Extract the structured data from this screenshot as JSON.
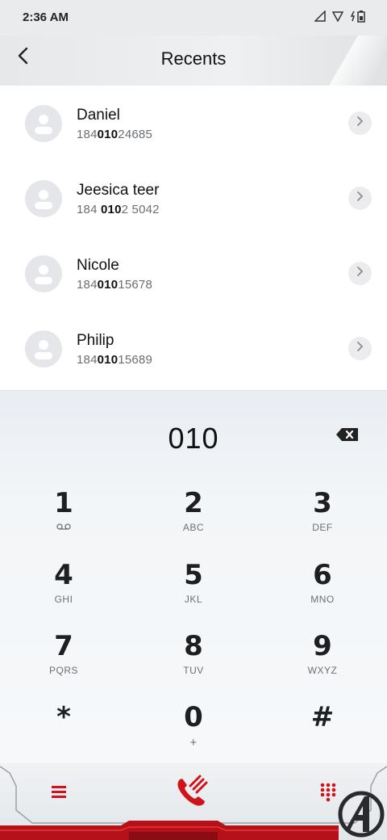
{
  "status_bar": {
    "time": "2:36 AM",
    "icons": [
      "signal-icon",
      "wifi-icon",
      "battery-charging-icon"
    ]
  },
  "header": {
    "title": "Recents",
    "back_icon": "back-arrow-icon"
  },
  "contacts": [
    {
      "name": "Daniel",
      "number_parts": [
        "184",
        "010",
        "24685"
      ]
    },
    {
      "name": "Jeesica teer",
      "number_parts": [
        "184 ",
        "010",
        "2 5042"
      ]
    },
    {
      "name": "Nicole",
      "number_parts": [
        "184",
        "010",
        "15678"
      ]
    },
    {
      "name": "Philip",
      "number_parts": [
        "184",
        "010",
        "15689"
      ]
    }
  ],
  "dialer": {
    "input_value": "010",
    "keys": [
      {
        "digit": "1",
        "letters": ""
      },
      {
        "digit": "2",
        "letters": "ABC"
      },
      {
        "digit": "3",
        "letters": "DEF"
      },
      {
        "digit": "4",
        "letters": "GHI"
      },
      {
        "digit": "5",
        "letters": "JKL"
      },
      {
        "digit": "6",
        "letters": "MNO"
      },
      {
        "digit": "7",
        "letters": "PQRS"
      },
      {
        "digit": "8",
        "letters": "TUV"
      },
      {
        "digit": "9",
        "letters": "WXYZ"
      },
      {
        "digit": "*",
        "letters": ""
      },
      {
        "digit": "0",
        "letters": "+"
      },
      {
        "digit": "#",
        "letters": ""
      }
    ]
  },
  "bottom_bar": {
    "icons": [
      "menu-icon",
      "phone-call-icon",
      "dialpad-icon",
      "avengers-logo"
    ]
  },
  "colors": {
    "accent": "#d0121b",
    "text": "#111111",
    "subtext": "#6b6e73"
  }
}
